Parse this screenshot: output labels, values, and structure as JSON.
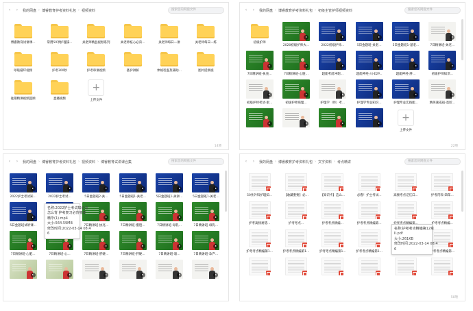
{
  "search_placeholder": "搜索您的网盘文件",
  "panels": [
    {
      "breadcrumb": [
        "我的网盘",
        "博睿教育护考资料礼包",
        "视频资料"
      ],
      "count": "14项",
      "items": [
        {
          "kind": "folder",
          "label": "博睿教育试讲课..."
        },
        {
          "kind": "folder",
          "label": "常用50项护理操..."
        },
        {
          "kind": "folder",
          "label": "关老师精品视频系列"
        },
        {
          "kind": "folder",
          "label": "关老师核心必背..."
        },
        {
          "kind": "folder",
          "label": "关老师每日一讲"
        },
        {
          "kind": "folder",
          "label": "关老师每日一练"
        },
        {
          "kind": "folder",
          "label": "呼吸循环视频"
        },
        {
          "kind": "folder",
          "label": "护考300秒"
        },
        {
          "kind": "folder",
          "label": "护考串讲视频"
        },
        {
          "kind": "folder",
          "label": "基护讲解"
        },
        {
          "kind": "folder",
          "label": "体格检查及辅助..."
        },
        {
          "kind": "folder",
          "label": "图片提纲视"
        },
        {
          "kind": "folder",
          "label": "往期精讲视频回顾"
        },
        {
          "kind": "folder",
          "label": "直播视频"
        },
        {
          "kind": "add",
          "label": "上传文件"
        }
      ]
    },
    {
      "breadcrumb": [
        "我的网盘",
        "博睿教育护考资料礼包",
        "初级主管护师视频资料"
      ],
      "count": "22项",
      "items": [
        {
          "kind": "folder",
          "label": "初级护师"
        },
        {
          "kind": "video",
          "style": "green",
          "label": "2020初级护师大..."
        },
        {
          "kind": "video",
          "style": "blue",
          "label": "2022初级护师..."
        },
        {
          "kind": "video",
          "style": "blue",
          "label": "5日金题班-关老..."
        },
        {
          "kind": "video",
          "style": "blue",
          "label": "5日金题班1-基老..."
        },
        {
          "kind": "video",
          "style": "white",
          "label": "7日精讲班-关老..."
        },
        {
          "kind": "video",
          "style": "green",
          "label": "7日精讲班-执兆..."
        },
        {
          "kind": "video",
          "style": "green",
          "label": "7日精讲班-心脏..."
        },
        {
          "kind": "video",
          "style": "blue",
          "label": "超能考前冲刺..."
        },
        {
          "kind": "video",
          "style": "blue",
          "label": "超能神经-川-E2P..."
        },
        {
          "kind": "video",
          "style": "blue",
          "label": "超能神经-肝..."
        },
        {
          "kind": "video",
          "style": "blue",
          "label": "初级护师知识..."
        },
        {
          "kind": "video",
          "style": "white",
          "label": "初级护师考试-索..."
        },
        {
          "kind": "video",
          "style": "green",
          "label": "初级护师病理..."
        },
        {
          "kind": "video",
          "style": "white",
          "label": "护理学（师）考..."
        },
        {
          "kind": "video",
          "style": "blue",
          "label": "护理学专业知识..."
        },
        {
          "kind": "video",
          "style": "blue",
          "label": "护理专业实践能..."
        },
        {
          "kind": "video",
          "style": "white",
          "label": "精英速成班-高阶..."
        },
        {
          "kind": "video",
          "style": "green",
          "label": ""
        },
        {
          "kind": "video",
          "style": "white",
          "label": ""
        },
        {
          "kind": "video",
          "style": "green",
          "label": ""
        },
        {
          "kind": "video",
          "style": "blue",
          "label": ""
        },
        {
          "kind": "add",
          "label": "上传文件"
        }
      ]
    },
    {
      "breadcrumb": [
        "我的网盘",
        "博睿教育护考资料礼包",
        "视频资料",
        "博睿教育试讲课合集"
      ],
      "items": [
        {
          "kind": "video",
          "style": "blue",
          "label": "2022护士考试知..."
        },
        {
          "kind": "video",
          "style": "blue",
          "label": "2022护士考试..."
        },
        {
          "kind": "video",
          "style": "blue",
          "label": "5日金题班2-关..."
        },
        {
          "kind": "video",
          "style": "blue",
          "label": "5日金题班1-关老..."
        },
        {
          "kind": "video",
          "style": "blue",
          "label": "5日金题班1-关讲..."
        },
        {
          "kind": "video",
          "style": "blue",
          "label": "5日金题班1-关老..."
        },
        {
          "kind": "video",
          "style": "blue",
          "label": "5日金题班试听课..."
        },
        {
          "kind": "video",
          "style": "blue",
          "label": ""
        },
        {
          "kind": "video",
          "style": "green",
          "label": "7日精讲班-执兆..."
        },
        {
          "kind": "video",
          "style": "green",
          "label": "7日精讲班-慢阻..."
        },
        {
          "kind": "video",
          "style": "green",
          "label": "7日精讲班-母乳..."
        },
        {
          "kind": "video",
          "style": "green",
          "label": "7日精讲班-母乳..."
        },
        {
          "kind": "video",
          "style": "green",
          "label": "7日精讲班-心脏..."
        },
        {
          "kind": "video",
          "style": "green",
          "label": "7日精讲班-心..."
        },
        {
          "kind": "video",
          "style": "green",
          "label": "7日精讲班-肝硬..."
        },
        {
          "kind": "video",
          "style": "green",
          "label": "7日精讲班-肝硬..."
        },
        {
          "kind": "video",
          "style": "green",
          "label": "7日精讲班-吸..."
        },
        {
          "kind": "video",
          "style": "green",
          "label": "7日精讲班-孕产..."
        },
        {
          "kind": "video",
          "style": "light",
          "label": ""
        },
        {
          "kind": "video",
          "style": "light",
          "label": ""
        },
        {
          "kind": "video",
          "style": "white",
          "label": ""
        },
        {
          "kind": "video",
          "style": "white",
          "label": ""
        },
        {
          "kind": "video",
          "style": "white",
          "label": ""
        },
        {
          "kind": "video",
          "style": "white",
          "label": ""
        }
      ],
      "tooltip": [
        "名称:2022护士考试知识点",
        "怎么背 护考复习必背吸痰",
        "精华(1).mp4",
        "大小:564.59MB",
        "修改时间:2022-03-14 08:4",
        "6"
      ]
    },
    {
      "breadcrumb": [
        "我的网盘",
        "博睿教育护考资料礼包",
        "文字资料",
        "考点精讲"
      ],
      "count": "50项",
      "items": [
        {
          "kind": "doc",
          "label": "50条外科护理知..."
        },
        {
          "kind": "doc",
          "label": "【收藏重要】必..."
        },
        {
          "kind": "doc",
          "label": "【知识卡】这么..."
        },
        {
          "kind": "doc",
          "label": "必看！护士考试..."
        },
        {
          "kind": "doc",
          "label": "高频考点记忆口..."
        },
        {
          "kind": "doc",
          "label": "护考内科-四年..."
        },
        {
          "kind": "doc",
          "label": "护考高频易错..."
        },
        {
          "kind": "doc",
          "label": "护考考点..."
        },
        {
          "kind": "doc",
          "label": "护考考点精编..."
        },
        {
          "kind": "doc",
          "label": "护考考点精编第..."
        },
        {
          "kind": "doc",
          "label": "护考考点精编第..."
        },
        {
          "kind": "doc",
          "label": "护考考点精编..."
        },
        {
          "kind": "doc",
          "label": "护考考点精编第1..."
        },
        {
          "kind": "doc",
          "label": "护考考点精编第1..."
        },
        {
          "kind": "doc",
          "label": "护考考点精编第1..."
        },
        {
          "kind": "doc",
          "label": "护考考点精编第1..."
        },
        {
          "kind": "doc",
          "label": "护考考点精编第1..."
        },
        {
          "kind": "doc",
          "label": "护考考点精编第..."
        },
        {
          "kind": "doc",
          "label": ""
        },
        {
          "kind": "doc",
          "label": ""
        },
        {
          "kind": "doc",
          "label": ""
        },
        {
          "kind": "doc",
          "label": ""
        },
        {
          "kind": "doc",
          "label": ""
        },
        {
          "kind": "doc",
          "label": ""
        }
      ],
      "tooltip": [
        "名称:护考考点精编第12章",
        "II.pdf",
        "大小:261KB",
        "修改时间:2022-03-14 08:4",
        "6"
      ]
    }
  ]
}
